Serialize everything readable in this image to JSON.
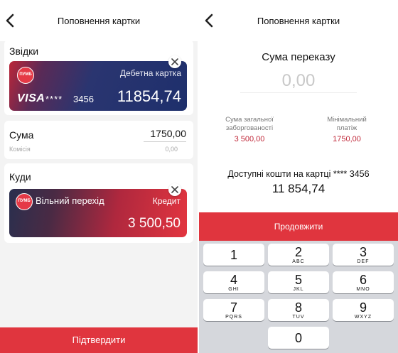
{
  "left": {
    "title": "Поповнення картки",
    "from": {
      "label": "Звідки",
      "card": {
        "logo": "ПУМБ",
        "type": "Дебетна картка",
        "brand": "VISA",
        "mask": "****",
        "last4": "3456",
        "balance": "11854,74"
      }
    },
    "amount": {
      "label": "Сума",
      "value": "1750,00",
      "commission_label": "Комісія",
      "commission_value": "0,00"
    },
    "to": {
      "label": "Куди",
      "card": {
        "logo": "ПУМБ",
        "name": "Вільний перехід",
        "type": "Кредит",
        "balance": "3 500,50"
      }
    },
    "confirm_label": "Підтвердити"
  },
  "right": {
    "title": "Поповнення картки",
    "heading": "Сума переказу",
    "amount_placeholder": "0,00",
    "total_debt_label": "Сума загальної заборгованості",
    "total_debt_value": "3 500,00",
    "min_payment_label": "Мінімальний платіж",
    "min_payment_value": "1750,00",
    "available_label": "Доступні кошти на картці **** 3456",
    "available_value": "11 854,74",
    "continue_label": "Продовжити"
  },
  "keypad": {
    "keys": [
      {
        "digit": "1",
        "letters": ""
      },
      {
        "digit": "2",
        "letters": "ABC"
      },
      {
        "digit": "3",
        "letters": "DEF"
      },
      {
        "digit": "4",
        "letters": "GHI"
      },
      {
        "digit": "5",
        "letters": "JKL"
      },
      {
        "digit": "6",
        "letters": "MNO"
      },
      {
        "digit": "7",
        "letters": "PQRS"
      },
      {
        "digit": "8",
        "letters": "TUV"
      },
      {
        "digit": "9",
        "letters": "WXYZ"
      },
      {
        "digit": "0",
        "letters": ""
      }
    ]
  },
  "colors": {
    "accent_red": "#e0353e",
    "value_red": "#c0293a",
    "card_blue": "#1e2f6c",
    "keypad_bg": "#d5d7dc"
  },
  "icons": {
    "back": "chevron-left-icon",
    "remove": "close-icon"
  }
}
